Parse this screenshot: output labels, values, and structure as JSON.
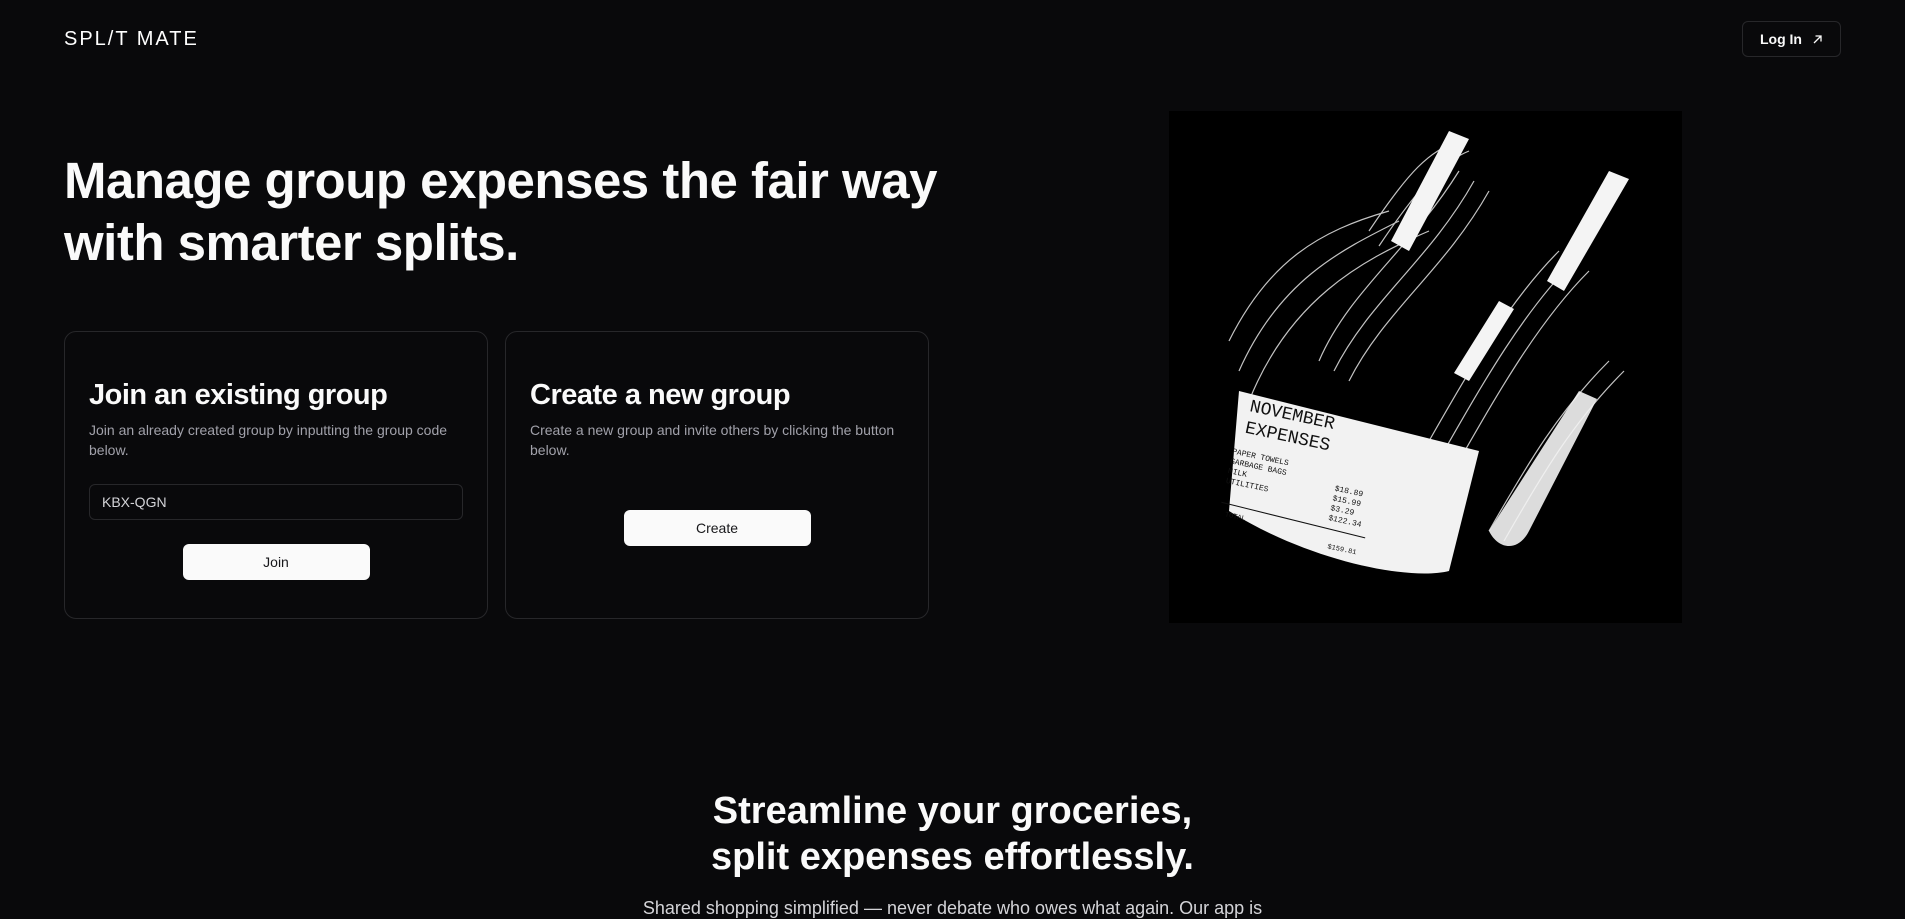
{
  "header": {
    "logo": "SPL/T MATE",
    "login_label": "Log In",
    "login_icon": "arrow-up-right-icon"
  },
  "hero": {
    "title": "Manage group expenses the fair way with smarter splits."
  },
  "join_card": {
    "title": "Join an existing group",
    "description": "Join an already created group by inputting the group code below.",
    "input_value": "KBX-QGN",
    "button_label": "Join"
  },
  "create_card": {
    "title": "Create a new group",
    "description": "Create a new group and invite others by clicking the button below.",
    "button_label": "Create"
  },
  "illustration": {
    "receipt_title_1": "NOVEMBER",
    "receipt_title_2": "EXPENSES",
    "items": [
      {
        "name": "PAPER TOWELS",
        "price": "$18.89"
      },
      {
        "name": "GARBAGE BAGS",
        "price": "$15.99"
      },
      {
        "name": "MILK",
        "price": "$3.29"
      },
      {
        "name": "UTILITIES",
        "price": "$122.34"
      }
    ],
    "total_label": "TOTAL",
    "total_value": "$159.81"
  },
  "section": {
    "title": "Streamline your groceries, split expenses effortlessly.",
    "text": "Shared shopping simplified — never debate who owes what again. Our app is"
  }
}
